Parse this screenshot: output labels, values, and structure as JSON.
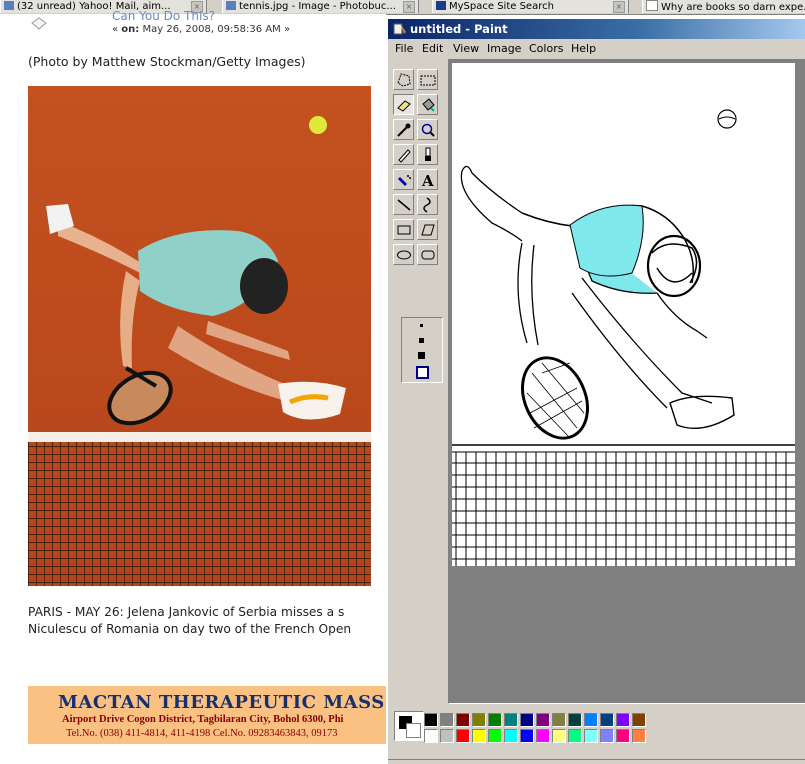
{
  "taskbar": {
    "tabs": [
      {
        "label": "(32 unread) Yahoo! Mail, aim..."
      },
      {
        "label": "tennis.jpg - Image - Photobuc..."
      },
      {
        "label": "MySpace Site Search"
      },
      {
        "label": "Why are books so darn expe..."
      }
    ]
  },
  "webpage": {
    "post_title": "Can You Do This?",
    "post_meta_on": "on:",
    "post_meta_date": "May 26, 2008, 09:58:36 AM",
    "photo_credit": "(Photo by Matthew Stockman/Getty Images)",
    "caption_line1": "PARIS - MAY 26: Jelena Jankovic of Serbia misses a s",
    "caption_line2": "Niculescu of Romania on day two of the French Open",
    "ad": {
      "title": "MACTAN THERAPEUTIC MASS",
      "address": "Airport Drive Cogon District, Tagbilaran City, Bohol 6300, Phi",
      "phones": "Tel.No. (038) 411-4814, 411-4198   Cel.No. 09283463843, 09173"
    }
  },
  "paint": {
    "title": "untitled - Paint",
    "menu": [
      "File",
      "Edit",
      "View",
      "Image",
      "Colors",
      "Help"
    ],
    "tools": [
      "free-form-select",
      "select",
      "eraser",
      "fill-with-color",
      "pick-color",
      "magnifier",
      "pencil",
      "brush",
      "airbrush",
      "text",
      "line",
      "curve",
      "rectangle",
      "polygon",
      "ellipse",
      "rounded-rectangle"
    ],
    "active_tool": "eraser",
    "colors": {
      "foreground": "#000000",
      "background": "#ffffff",
      "palette_row1": [
        "#000000",
        "#808080",
        "#800000",
        "#808000",
        "#008000",
        "#008080",
        "#000080",
        "#800080",
        "#808040",
        "#004040",
        "#0080ff",
        "#004080",
        "#8000ff",
        "#804000"
      ],
      "palette_row2": [
        "#ffffff",
        "#c0c0c0",
        "#ff0000",
        "#ffff00",
        "#00ff00",
        "#00ffff",
        "#0000ff",
        "#ff00ff",
        "#ffff80",
        "#00ff80",
        "#80ffff",
        "#8080ff",
        "#ff0080",
        "#ff8040"
      ]
    }
  }
}
